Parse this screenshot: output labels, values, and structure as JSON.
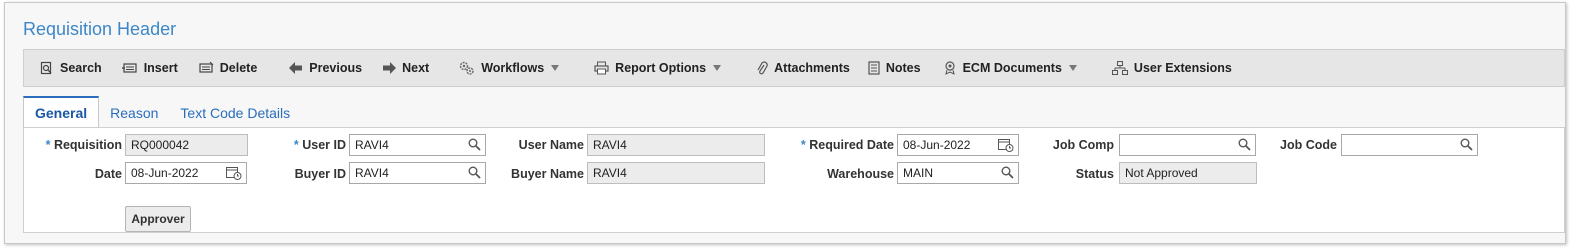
{
  "page": {
    "title": "Requisition Header"
  },
  "toolbar": {
    "search": "Search",
    "insert": "Insert",
    "delete": "Delete",
    "previous": "Previous",
    "next": "Next",
    "workflows": "Workflows",
    "report_options": "Report Options",
    "attachments": "Attachments",
    "notes": "Notes",
    "ecm_documents": "ECM Documents",
    "user_extensions": "User Extensions"
  },
  "tabs": [
    {
      "label": "General",
      "active": true
    },
    {
      "label": "Reason",
      "active": false
    },
    {
      "label": "Text Code Details",
      "active": false
    }
  ],
  "form": {
    "required_marker": "*",
    "requisition": {
      "label": "Requisition",
      "value": "RQ000042"
    },
    "user_id": {
      "label": "User ID",
      "value": "RAVI4"
    },
    "user_name": {
      "label": "User Name",
      "value": "RAVI4"
    },
    "required_date": {
      "label": "Required Date",
      "value": "08-Jun-2022"
    },
    "job_comp": {
      "label": "Job Comp",
      "value": ""
    },
    "job_code": {
      "label": "Job Code",
      "value": ""
    },
    "date": {
      "label": "Date",
      "value": "08-Jun-2022"
    },
    "buyer_id": {
      "label": "Buyer ID",
      "value": "RAVI4"
    },
    "buyer_name": {
      "label": "Buyer Name",
      "value": "RAVI4"
    },
    "warehouse": {
      "label": "Warehouse",
      "value": "MAIN"
    },
    "status": {
      "label": "Status",
      "value": "Not Approved"
    }
  },
  "buttons": {
    "approver": "Approver"
  },
  "icons": {
    "search": "search-icon",
    "insert": "insert-icon",
    "delete": "delete-icon",
    "previous": "arrow-left-icon",
    "next": "arrow-right-icon",
    "workflows": "gears-icon",
    "report_options": "printer-icon",
    "attachments": "paperclip-icon",
    "notes": "notes-icon",
    "ecm_documents": "ecm-icon",
    "user_extensions": "hierarchy-icon",
    "lookup": "magnifier-icon",
    "calendar": "calendar-icon",
    "dropdown": "chevron-down-icon"
  },
  "colors": {
    "title": "#3c87c8",
    "tab_active": "#2a6ebb",
    "toolbar_bg": "#e6e6e6"
  }
}
